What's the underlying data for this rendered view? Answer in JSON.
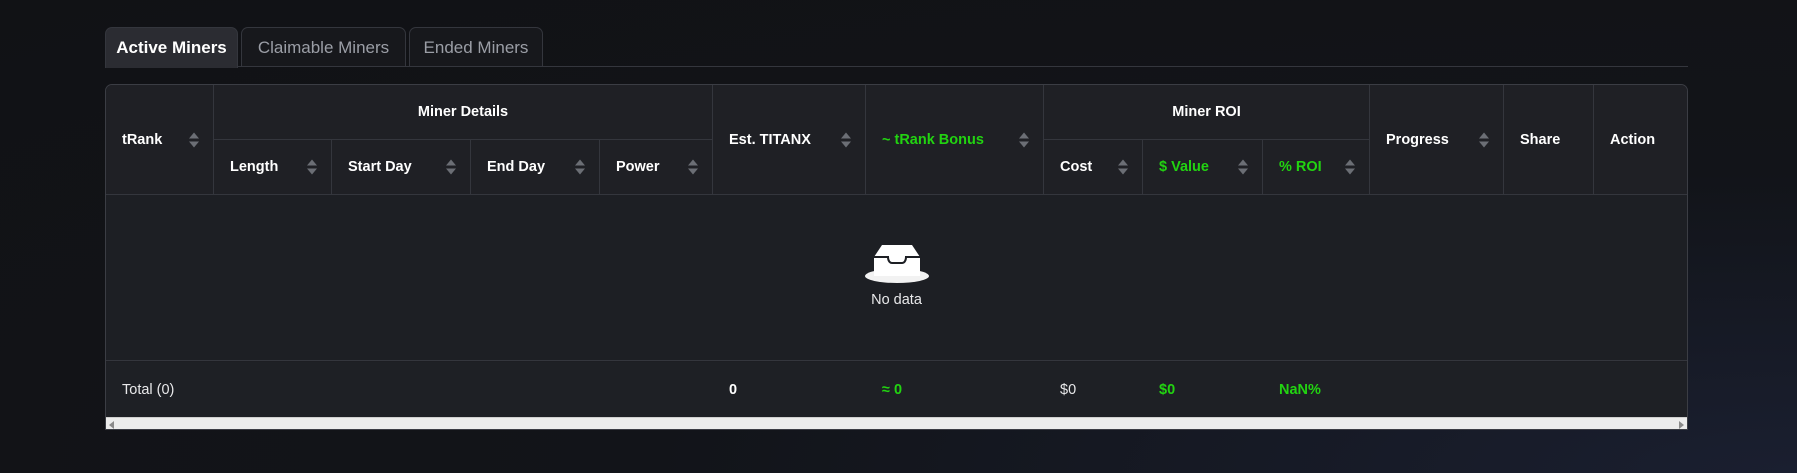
{
  "tabs": [
    {
      "label": "Active Miners",
      "active": true
    },
    {
      "label": "Claimable Miners",
      "active": false
    },
    {
      "label": "Ended Miners",
      "active": false
    }
  ],
  "table": {
    "group_headers": {
      "miner_details": "Miner Details",
      "miner_roi": "Miner ROI"
    },
    "columns": {
      "trank": "tRank",
      "length": "Length",
      "start_day": "Start Day",
      "end_day": "End Day",
      "power": "Power",
      "est_titanx": "Est. TITANX",
      "trank_bonus": "~ tRank Bonus",
      "cost": "Cost",
      "value": "$ Value",
      "roi": "% ROI",
      "progress": "Progress",
      "share": "Share",
      "action": "Action"
    },
    "empty_text": "No data",
    "empty_icon": "inbox-icon",
    "footer": {
      "total": "Total (0)",
      "est_titanx": "0",
      "trank_bonus": "≈ 0",
      "cost": "$0",
      "value": "$0",
      "roi": "NaN%"
    }
  },
  "colors": {
    "accent_green": "#22d311",
    "background": "#121419",
    "table_bg": "#1d1e23",
    "border": "#34363d"
  }
}
